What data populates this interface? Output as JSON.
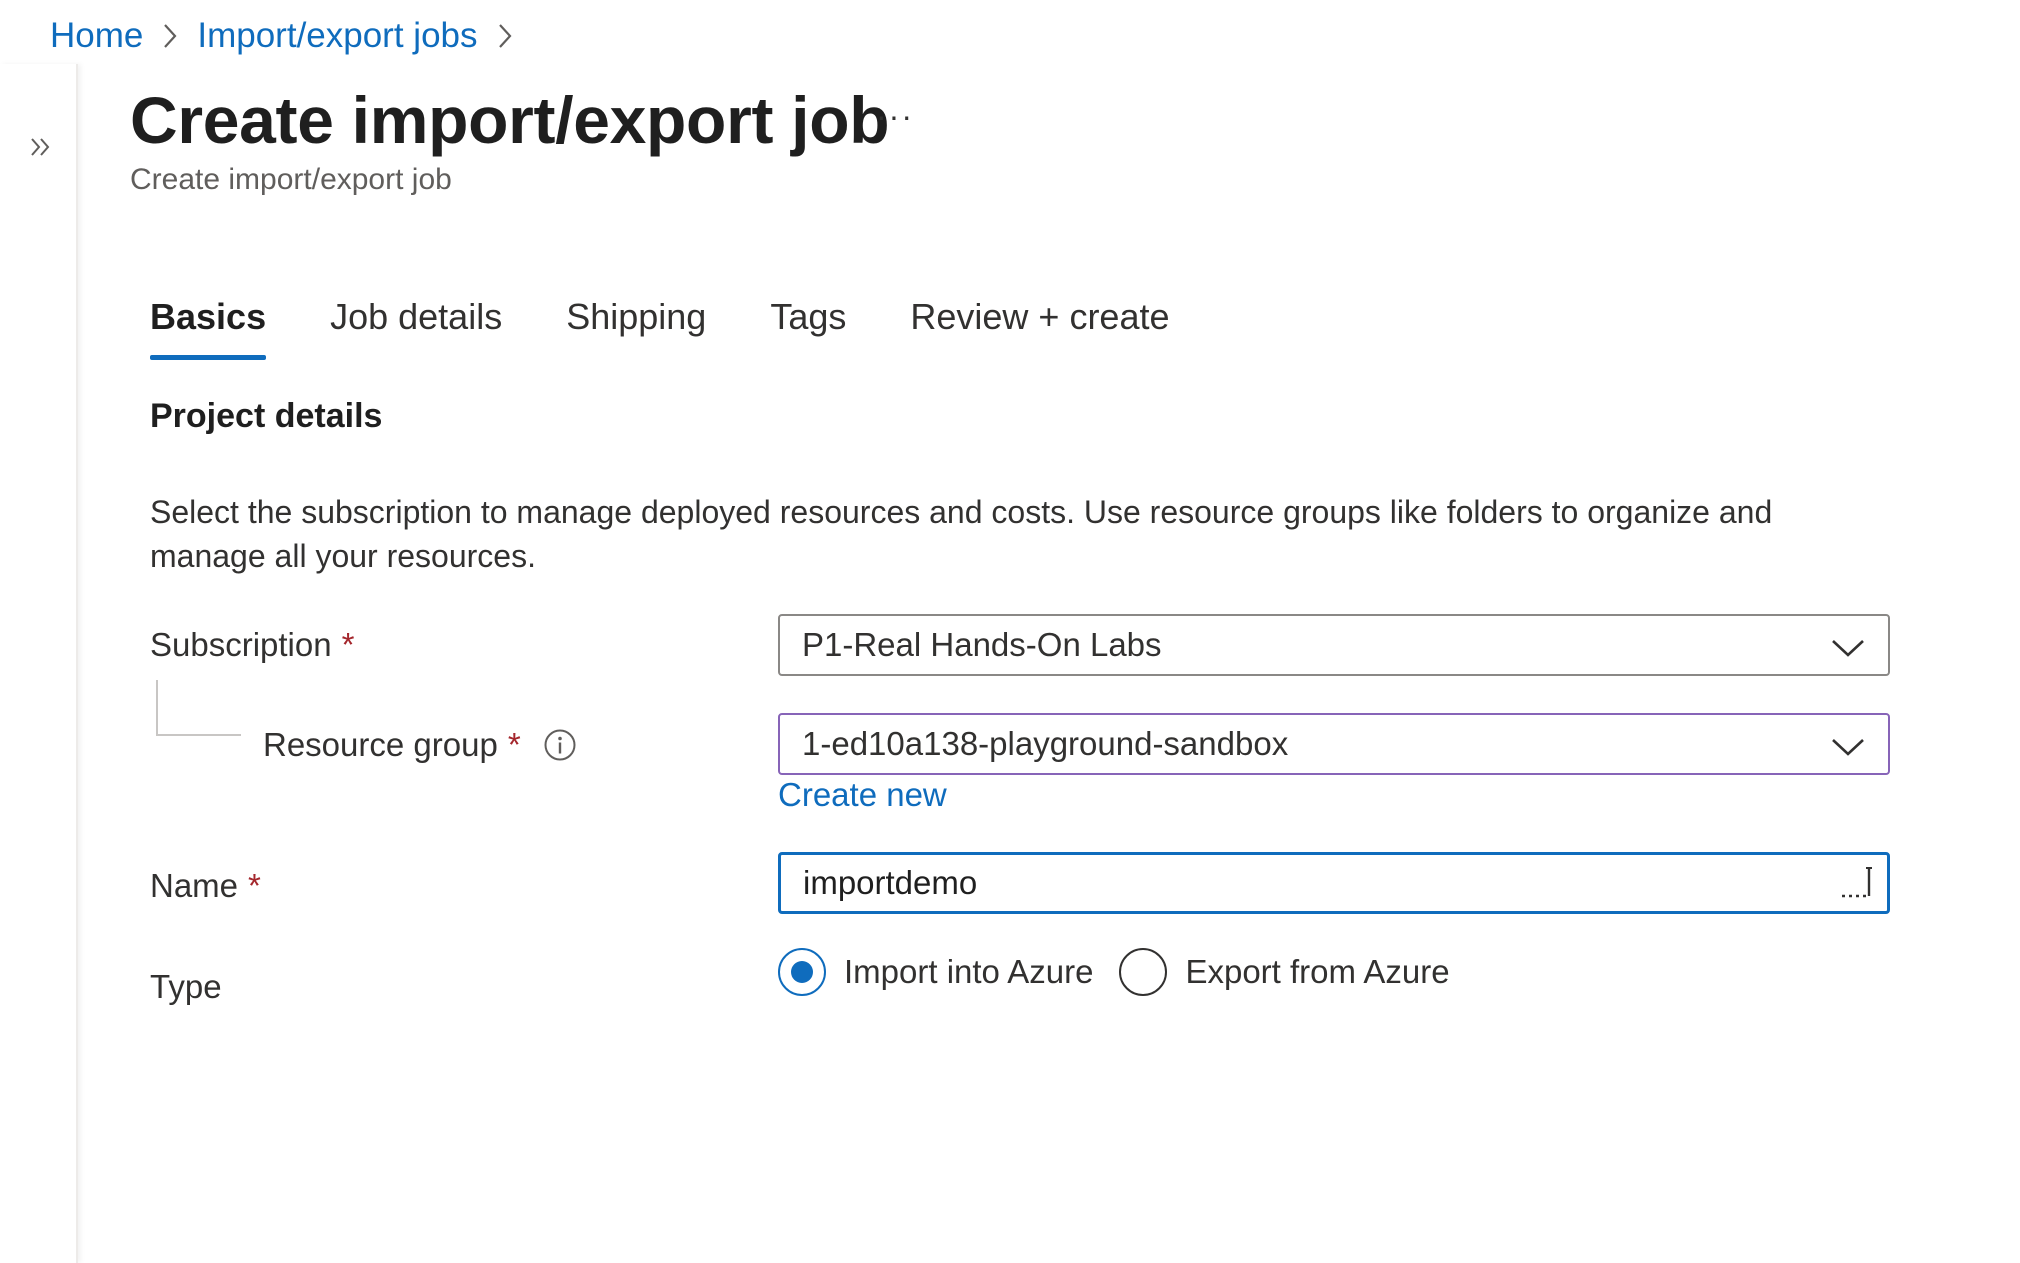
{
  "breadcrumb": {
    "items": [
      "Home",
      "Import/export jobs"
    ]
  },
  "header": {
    "title": "Create import/export job",
    "more_label": "···",
    "subtitle": "Create import/export job"
  },
  "tabs": [
    {
      "label": "Basics",
      "active": true
    },
    {
      "label": "Job details",
      "active": false
    },
    {
      "label": "Shipping",
      "active": false
    },
    {
      "label": "Tags",
      "active": false
    },
    {
      "label": "Review + create",
      "active": false
    }
  ],
  "project_details": {
    "title": "Project details",
    "description": "Select the subscription to manage deployed resources and costs. Use resource groups like folders to organize and manage all your resources."
  },
  "form": {
    "subscription": {
      "label": "Subscription",
      "required_mark": "*",
      "value": "P1-Real Hands-On Labs"
    },
    "resource_group": {
      "label": "Resource group",
      "required_mark": "*",
      "value": "1-ed10a138-playground-sandbox",
      "create_new_label": "Create new"
    },
    "name": {
      "label": "Name",
      "required_mark": "*",
      "value": "importdemo"
    },
    "type": {
      "label": "Type",
      "options": [
        {
          "label": "Import into Azure",
          "selected": true
        },
        {
          "label": "Export from Azure",
          "selected": false
        }
      ]
    }
  },
  "colors": {
    "accent": "#0f6cbd",
    "required": "#a4262c",
    "focus_dropdown": "#8764b8"
  },
  "icons": {
    "expand": "double-chevron-right-icon",
    "breadcrumb_separator": "chevron-right-icon",
    "dropdown": "chevron-down-icon",
    "info": "info-icon"
  }
}
